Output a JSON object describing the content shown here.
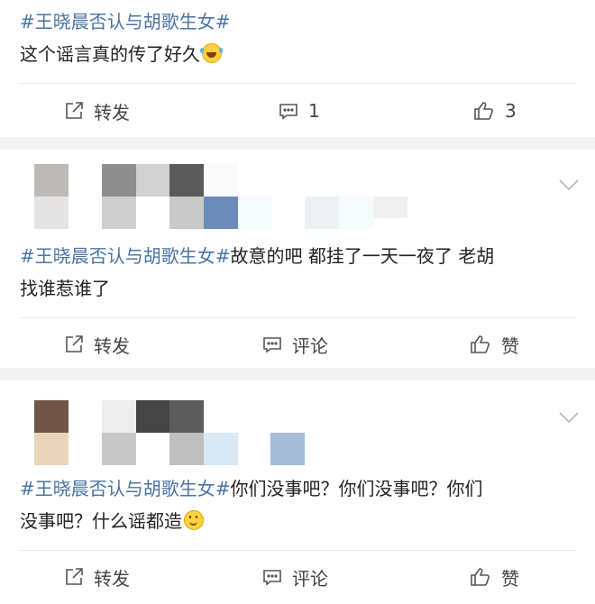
{
  "posts": [
    {
      "hashtag": "#王晓晨否认与胡歌生女#",
      "line1": "这个谣言真的传了好久",
      "line2": "",
      "emoji": "laugh-cry-emoji",
      "actions": {
        "repost": "转发",
        "comment": "1",
        "like": "3"
      }
    },
    {
      "hashtag": "#王晓晨否认与胡歌生女#",
      "line1": "故意的吧 都挂了一天一夜了 老胡",
      "line2": "找谁惹谁了",
      "actions": {
        "repost": "转发",
        "comment": "评论",
        "like": "赞"
      }
    },
    {
      "hashtag": "#王晓晨否认与胡歌生女#",
      "line1": "你们没事吧？你们没事吧？你们",
      "line2": "没事吧？什么谣都造",
      "emoji": "smile-emoji",
      "actions": {
        "repost": "转发",
        "comment": "评论",
        "like": "赞"
      }
    }
  ],
  "colors": {
    "hashtag": "#4a73a6",
    "separator": "#f2f2f2",
    "divider": "#e8e8e8"
  }
}
